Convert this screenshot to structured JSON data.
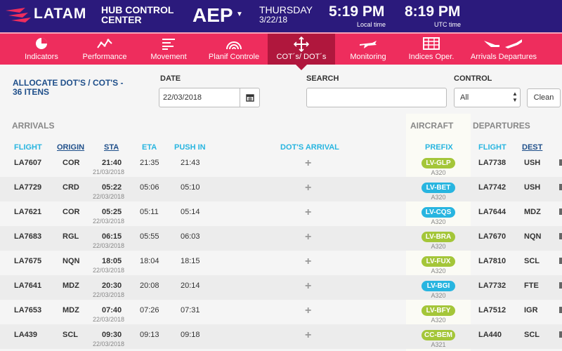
{
  "header": {
    "logo_text": "LATAM",
    "hub_line1": "HUB CONTROL",
    "hub_line2": "CENTER",
    "airport": "AEP",
    "day": "THURSDAY",
    "date": "3/22/18",
    "local_time": "5:19 PM",
    "local_label": "Local time",
    "utc_time": "8:19 PM",
    "utc_label": "UTC time"
  },
  "nav": [
    {
      "label": "Indicators",
      "icon": "pie-chart-icon"
    },
    {
      "label": "Performance",
      "icon": "line-chart-icon"
    },
    {
      "label": "Movement",
      "icon": "bars-icon"
    },
    {
      "label": "Planif Controle",
      "icon": "radar-arc-icon"
    },
    {
      "label": "COT´s/ DOT´s",
      "icon": "move-arrows-icon"
    },
    {
      "label": "Monitoring",
      "icon": "plane-icon"
    },
    {
      "label": "Indices Oper.",
      "icon": "table-icon"
    },
    {
      "label": "Arrivals Departures",
      "icon": "plane-land-takeoff-icon"
    }
  ],
  "controls": {
    "title_line1": "ALLOCATE DOT'S / COT'S -",
    "title_line2": "36 ITENS",
    "date_label": "DATE",
    "date_value": "22/03/2018",
    "search_label": "SEARCH",
    "search_value": "",
    "control_label": "CONTROL",
    "control_value": "All",
    "clean_label": "Clean"
  },
  "sections": {
    "arrivals": "ARRIVALS",
    "aircraft": "AIRCRAFT",
    "departures": "DEPARTURES"
  },
  "columns": {
    "flight": "FLIGHT",
    "origin": "ORIGIN",
    "sta": "STA",
    "eta": "ETA",
    "push_in": "PUSH IN",
    "dots_arrival": "DOT'S ARRIVAL",
    "prefix": "PREFIX",
    "dep_flight": "FLIGHT",
    "dest": "DEST"
  },
  "colors": {
    "header_bg": "#2b1a7c",
    "nav_bg": "#ee2d5d",
    "nav_active": "#b0173d",
    "badge_green": "#a4c639",
    "badge_blue": "#28b5e0",
    "col_header": "#28b5e0",
    "title_blue": "#1f4f8a"
  },
  "rows": [
    {
      "flight": "LA7607",
      "origin": "COR",
      "sta": "21:40",
      "sta_date": "21/03/2018",
      "eta": "21:35",
      "push_in": "21:43",
      "prefix": "LV-GLP",
      "badge_color": "green",
      "aircraft_type": "A320",
      "dep_flight": "LA7738",
      "dest": "USH"
    },
    {
      "flight": "LA7729",
      "origin": "CRD",
      "sta": "05:22",
      "sta_date": "22/03/2018",
      "eta": "05:06",
      "push_in": "05:10",
      "prefix": "LV-BET",
      "badge_color": "blue",
      "aircraft_type": "A320",
      "dep_flight": "LA7742",
      "dest": "USH"
    },
    {
      "flight": "LA7621",
      "origin": "COR",
      "sta": "05:25",
      "sta_date": "22/03/2018",
      "eta": "05:11",
      "push_in": "05:14",
      "prefix": "LV-CQS",
      "badge_color": "blue",
      "aircraft_type": "A320",
      "dep_flight": "LA7644",
      "dest": "MDZ"
    },
    {
      "flight": "LA7683",
      "origin": "RGL",
      "sta": "06:15",
      "sta_date": "22/03/2018",
      "eta": "05:55",
      "push_in": "06:03",
      "prefix": "LV-BRA",
      "badge_color": "green",
      "aircraft_type": "A320",
      "dep_flight": "LA7670",
      "dest": "NQN"
    },
    {
      "flight": "LA7675",
      "origin": "NQN",
      "sta": "18:05",
      "sta_date": "22/03/2018",
      "eta": "18:04",
      "push_in": "18:15",
      "prefix": "LV-FUX",
      "badge_color": "green",
      "aircraft_type": "A320",
      "dep_flight": "LA7810",
      "dest": "SCL"
    },
    {
      "flight": "LA7641",
      "origin": "MDZ",
      "sta": "20:30",
      "sta_date": "22/03/2018",
      "eta": "20:08",
      "push_in": "20:14",
      "prefix": "LV-BGI",
      "badge_color": "blue",
      "aircraft_type": "A320",
      "dep_flight": "LA7732",
      "dest": "FTE"
    },
    {
      "flight": "LA7653",
      "origin": "MDZ",
      "sta": "07:40",
      "sta_date": "22/03/2018",
      "eta": "07:26",
      "push_in": "07:31",
      "prefix": "LV-BFY",
      "badge_color": "green",
      "aircraft_type": "A320",
      "dep_flight": "LA7512",
      "dest": "IGR"
    },
    {
      "flight": "LA439",
      "origin": "SCL",
      "sta": "09:30",
      "sta_date": "22/03/2018",
      "eta": "09:13",
      "push_in": "09:18",
      "prefix": "CC-BEM",
      "badge_color": "green",
      "aircraft_type": "A321",
      "dep_flight": "LA440",
      "dest": "SCL"
    }
  ]
}
